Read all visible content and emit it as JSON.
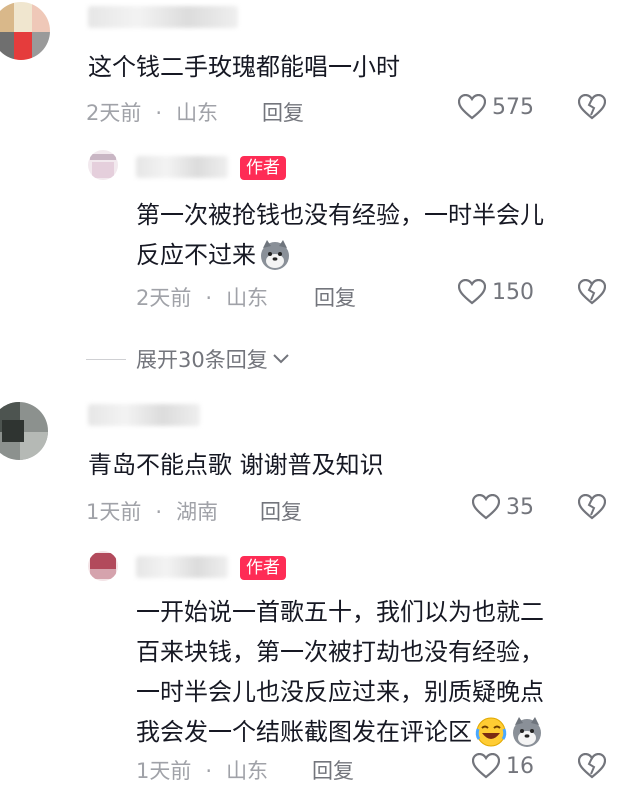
{
  "comments": [
    {
      "text_lines": [
        "这个钱二手玫瑰都能唱一小时"
      ],
      "time": "2天前",
      "location": "山东",
      "reply_label": "回复",
      "likes": "575"
    },
    {
      "author_tag": "作者",
      "text_lines": [
        "第一次被抢钱也没有经验，一时半会儿",
        "反应不过来"
      ],
      "time": "2天前",
      "location": "山东",
      "reply_label": "回复",
      "likes": "150"
    },
    {
      "text_lines": [
        "青岛不能点歌 谢谢普及知识"
      ],
      "time": "1天前",
      "location": "湖南",
      "reply_label": "回复",
      "likes": "35"
    },
    {
      "author_tag": "作者",
      "text_lines": [
        "一开始说一首歌五十，我们以为也就二",
        "百来块钱，第一次被打劫也没有经验，",
        "一时半会儿也没反应过来，别质疑晚点",
        "我会发一个结账截图发在评论区"
      ],
      "time": "1天前",
      "location": "山东",
      "reply_label": "回复",
      "likes": "16"
    }
  ],
  "expand_replies": "展开30条回复",
  "separator": "·",
  "icons": [
    "heart-outline-icon",
    "dislike-heart-icon",
    "dog-emoji-icon",
    "laugh-emoji-icon",
    "chevron-down-icon"
  ]
}
